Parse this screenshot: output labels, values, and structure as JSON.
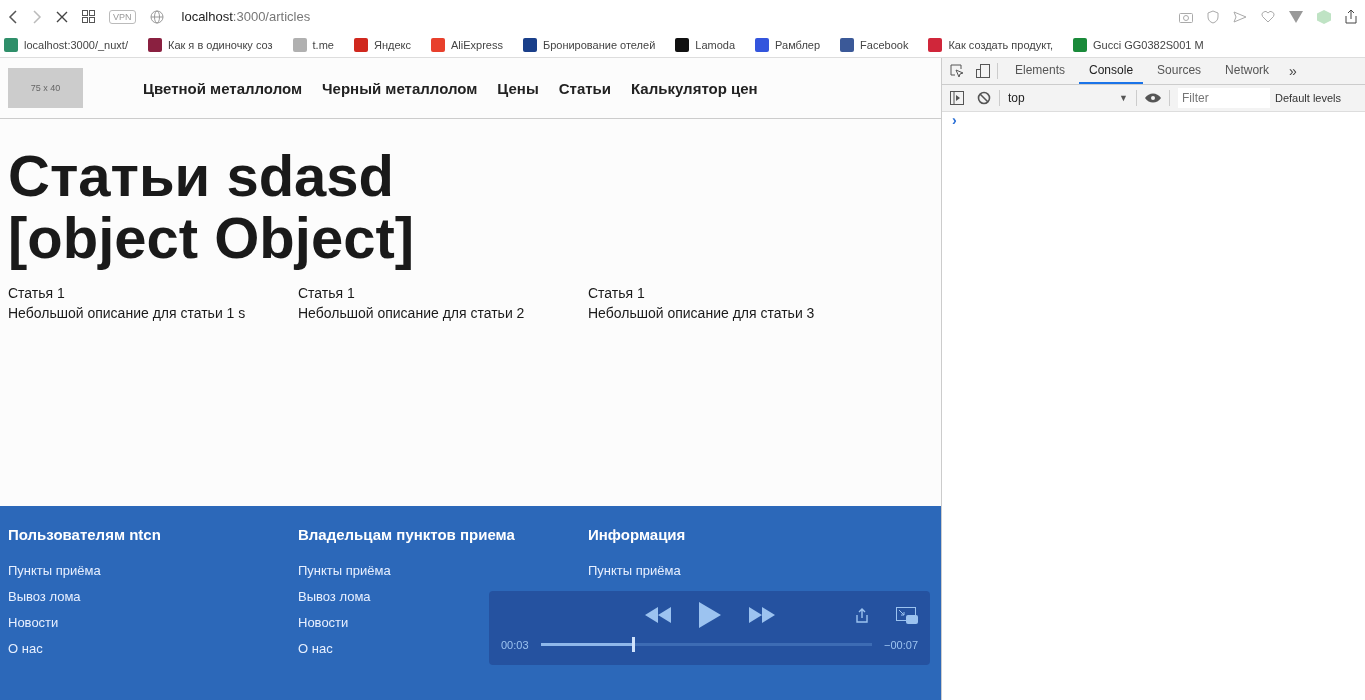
{
  "browser": {
    "url_host": "localhost",
    "url_path": ":3000/articles",
    "vpn": "VPN"
  },
  "bookmarks": [
    {
      "label": "localhost:3000/_nuxt/",
      "color": "#2f8f6a"
    },
    {
      "label": "Как я в одиночку соз",
      "color": "#8a2040"
    },
    {
      "label": "t.me",
      "color": "#b0b0b0"
    },
    {
      "label": "Яндекс",
      "color": "#d0281e"
    },
    {
      "label": "AliExpress",
      "color": "#e8402c"
    },
    {
      "label": "Бронирование отелей",
      "color": "#1a3f8a"
    },
    {
      "label": "Lamoda",
      "color": "#111111"
    },
    {
      "label": "Рамблер",
      "color": "#3355dd"
    },
    {
      "label": "Facebook",
      "color": "#3b5998"
    },
    {
      "label": "Как создать продукт,",
      "color": "#d0263a"
    },
    {
      "label": "Gucci GG0382S001 M",
      "color": "#1a8a3a"
    }
  ],
  "site": {
    "logo": "75 x 40",
    "nav": [
      "Цветной металлолом",
      "Черный металлолом",
      "Цены",
      "Статьи",
      "Калькулятор цен"
    ],
    "heading_lines": [
      "Статьи sdasd",
      "[object Object]"
    ],
    "articles": [
      {
        "title": "Статья 1",
        "description": "Небольшой описание для статьи 1 s"
      },
      {
        "title": "Статья 1",
        "description": "Небольшой описание для статьи 2"
      },
      {
        "title": "Статья 1",
        "description": "Небольшой описание для статьи 3"
      }
    ],
    "footer": [
      {
        "title": "Пользователям ntcn",
        "links": [
          "Пункты приёма",
          "Вывоз лома",
          "Новости",
          "О нас"
        ]
      },
      {
        "title": "Владельцам пунктов приема",
        "links": [
          "Пункты приёма",
          "Вывоз лома",
          "Новости",
          "О нас"
        ]
      },
      {
        "title": "Информация",
        "links": [
          "Пункты приёма"
        ]
      }
    ]
  },
  "player": {
    "elapsed": "00:03",
    "remaining": "−00:07",
    "level": 0.28
  },
  "devtools": {
    "tabs": [
      {
        "label": "Elements",
        "selected": false
      },
      {
        "label": "Console",
        "selected": true
      },
      {
        "label": "Sources",
        "selected": false
      },
      {
        "label": "Network",
        "selected": false
      }
    ],
    "more": "»",
    "context": "top",
    "context_caret": "▼",
    "filter_placeholder": "Filter",
    "levels": "Default levels",
    "prompt": "›"
  }
}
